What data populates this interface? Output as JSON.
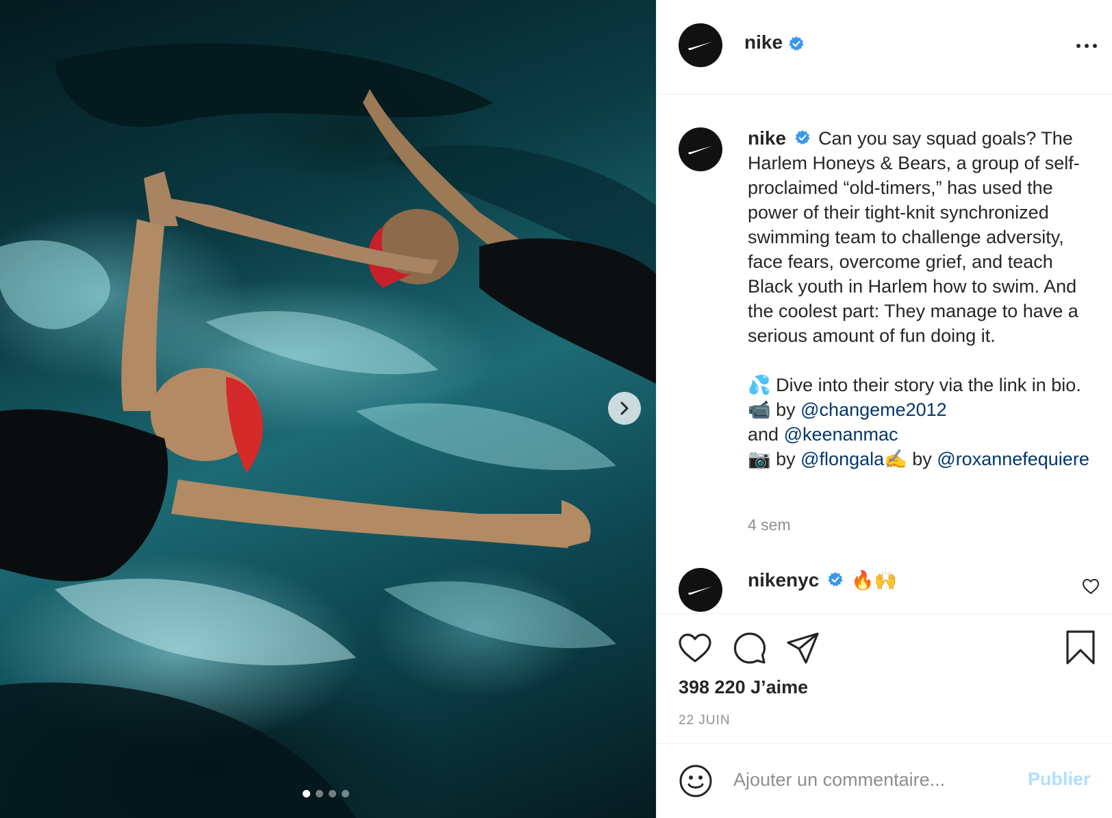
{
  "post": {
    "dots_total": 4,
    "dots_active": 1
  },
  "header": {
    "username": "nike",
    "avatar_icon": "nike-swoosh-icon",
    "more_icon": "more-options-icon"
  },
  "caption": {
    "username": "nike",
    "text_1": "Can you say squad goals? The Harlem Honeys & Bears, a group of self-proclaimed “old-timers,” has used the power of their tight-knit synchronized swimming team to challenge adversity, face fears, overcome grief, and teach Black youth in Harlem how to swim. And the coolest part: They manage to have a serious amount of fun doing it.",
    "line_dive": "💦 Dive into their story via the link in bio.📹 by ",
    "mention_1": "@changeme2012",
    "and_text": "and ",
    "mention_2": "@keenanmac",
    "camera_by": "📷 by ",
    "mention_3": "@flongala",
    "writing_by": "✍️ by ",
    "mention_4": "@roxannefequiere",
    "time_ago": "4 sem"
  },
  "reply": {
    "username": "nikenyc",
    "text": "🔥🙌"
  },
  "stats": {
    "likes": "398 220 J’aime",
    "date": "22 JUIN"
  },
  "composer": {
    "placeholder": "Ajouter un commentaire...",
    "publish_label": "Publier"
  },
  "colors": {
    "verified": "#3897f0",
    "mention": "#00376b",
    "publish_disabled": "#b2dffc",
    "muted": "#8e8e8e"
  }
}
